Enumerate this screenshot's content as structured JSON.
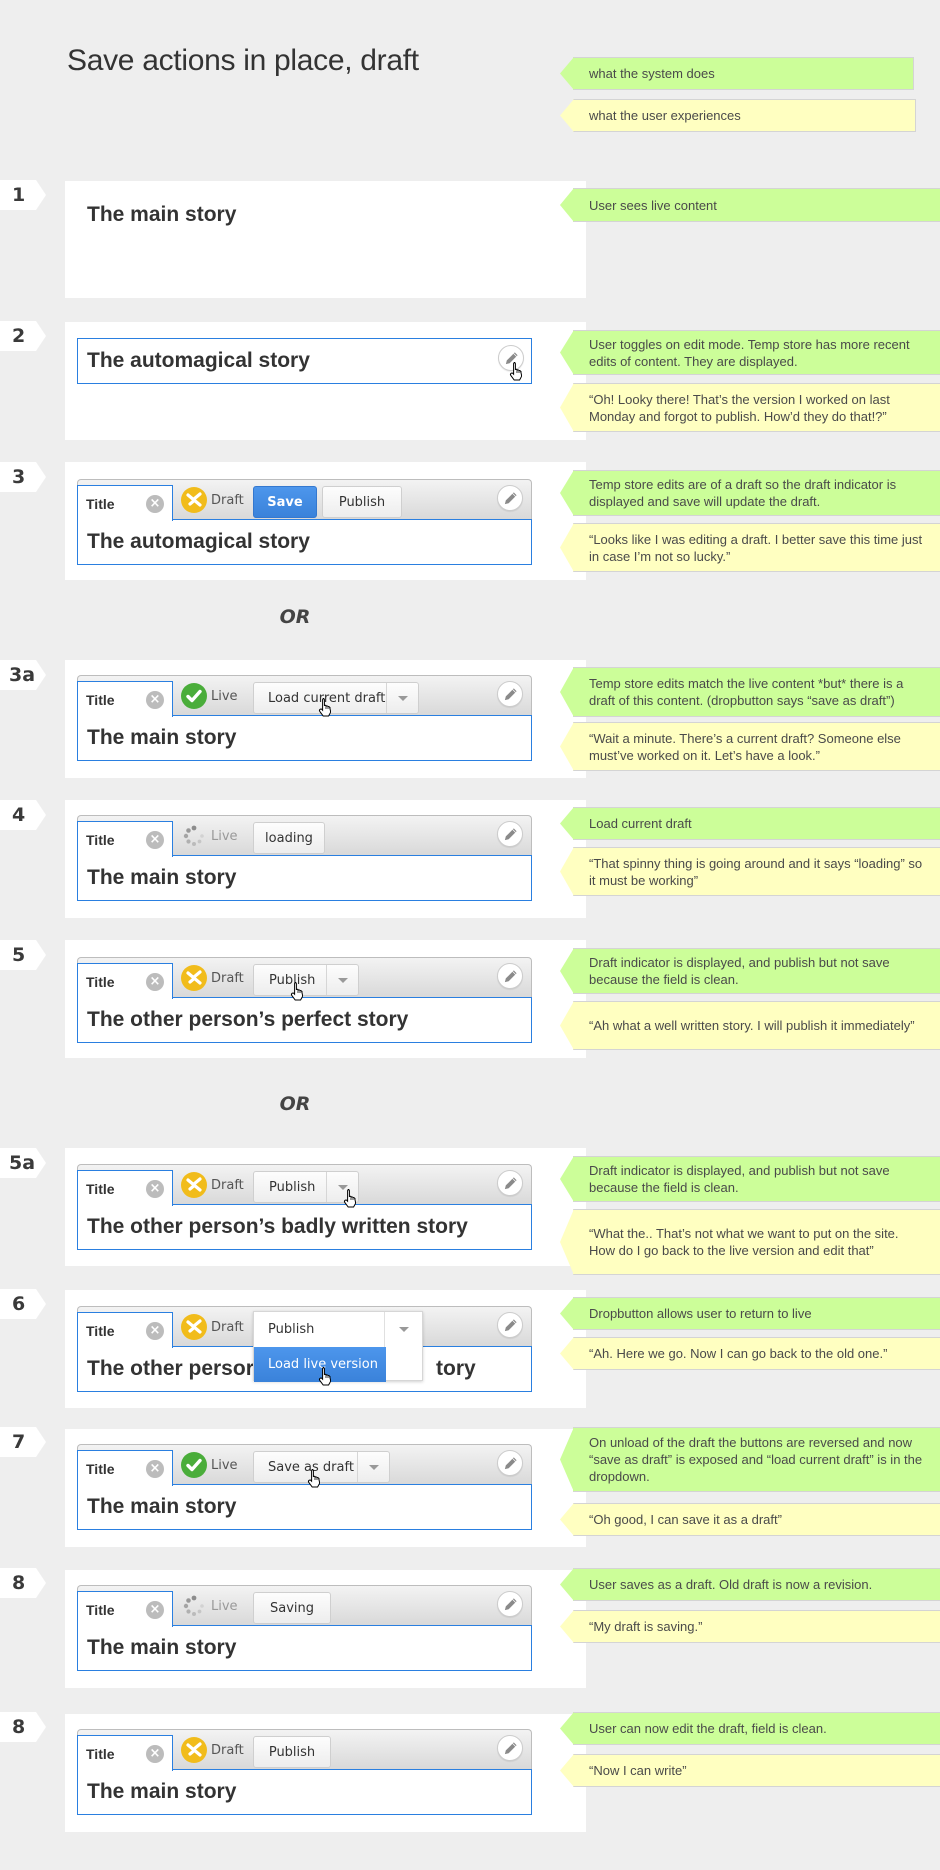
{
  "page_title": "Save actions in place, draft",
  "legend": {
    "system": "what the system does",
    "user": "what the user experiences"
  },
  "colors": {
    "system_note": "#ccfe99",
    "user_note": "#ffffc1",
    "accent_blue": "#3a82da",
    "draft_yellow": "#f1bc1b",
    "live_green": "#4aad3a"
  },
  "common": {
    "title_tab_label": "Title",
    "draft_label": "Draft",
    "live_label": "Live"
  },
  "or_label": "OR",
  "steps": [
    {
      "num": "1",
      "story": "The main story",
      "system_note": "User sees live content"
    },
    {
      "num": "2",
      "story": "The automagical story",
      "system_note": "User toggles on edit mode. Temp store has more recent edits of content. They are displayed.",
      "user_note": "“Oh! Looky there! That’s the version I worked on last Monday and forgot to publish. How’d they do that!?”"
    },
    {
      "num": "3",
      "story": "The automagical story",
      "status": "Draft",
      "buttons": [
        "Save",
        "Publish"
      ],
      "system_note": "Temp store edits are of a draft so the draft indicator is displayed and save will update the draft.",
      "user_note": "“Looks like I was editing a draft. I better save this time just in case I’m not so lucky.”"
    },
    {
      "num": "3a",
      "story": "The main story",
      "status": "Live",
      "buttons": [
        "Load current draft"
      ],
      "system_note": "Temp store edits match the live content *but* there is a draft of this content. (dropbutton says “save as draft”)",
      "user_note": "“Wait a minute. There’s a current draft? Someone else must’ve worked on it. Let’s have a look.”"
    },
    {
      "num": "4",
      "story": "The main story",
      "status": "Live",
      "buttons": [
        "loading"
      ],
      "system_note": "Load current draft",
      "user_note": "“That spinny thing is going around and it says “loading” so it must be working”"
    },
    {
      "num": "5",
      "story": "The other person’s perfect story",
      "status": "Draft",
      "buttons": [
        "Publish"
      ],
      "system_note": "Draft indicator is displayed, and  publish but not save because the field is clean.",
      "user_note": "“Ah what a well written story. I will publish it immediately”"
    },
    {
      "num": "5a",
      "story": "The other person’s badly written story",
      "status": "Draft",
      "buttons": [
        "Publish"
      ],
      "system_note": "Draft indicator is displayed, and  publish but not save because the field is clean.",
      "user_note": "“What the.. That’s not what we want to put on the site. How do I go back to the live version and edit that”"
    },
    {
      "num": "6",
      "story_left": "The other persor",
      "story_right": "tory",
      "status": "Draft",
      "dropdown": {
        "main": "Publish",
        "item": "Load live version"
      },
      "system_note": "Dropbutton allows user to return to live",
      "user_note": "“Ah. Here we go. Now I can go back to the old one.”"
    },
    {
      "num": "7",
      "story": "The main story",
      "status": "Live",
      "buttons": [
        "Save as draft"
      ],
      "system_note": "On unload of the draft the buttons are reversed and now “save as draft” is exposed and “load current draft” is in the dropdown.",
      "user_note": "“Oh good, I can save it as a draft”"
    },
    {
      "num": "8",
      "story": "The main story",
      "status": "Live",
      "buttons": [
        "Saving"
      ],
      "system_note": "User saves as a draft. Old draft is now a revision.",
      "user_note": "“My draft is saving.”"
    },
    {
      "num": "8",
      "story": "The main story",
      "status": "Draft",
      "buttons": [
        "Publish"
      ],
      "system_note": "User can now edit the draft, field is clean.",
      "user_note": "“Now I can write”"
    }
  ]
}
